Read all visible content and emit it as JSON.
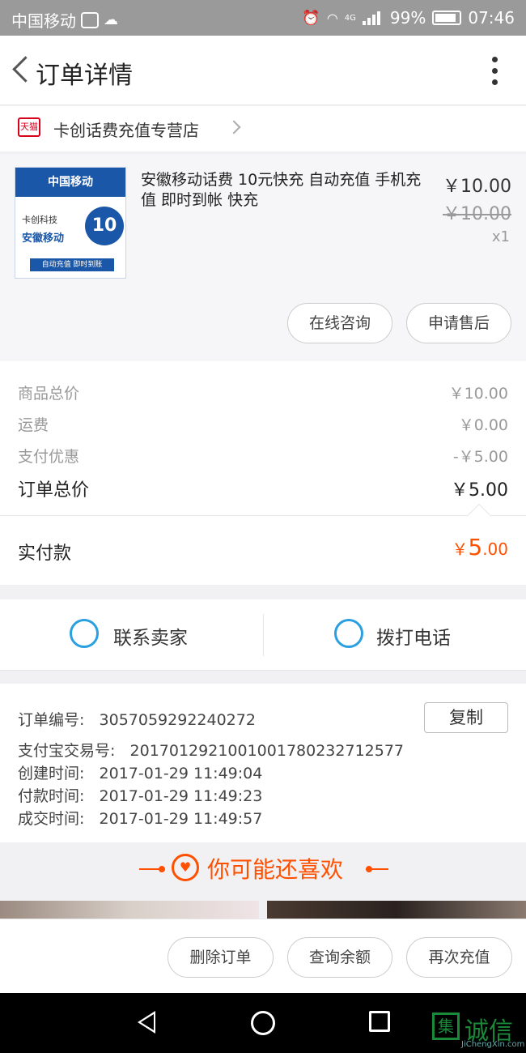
{
  "status_bar": {
    "carrier": "中国移动",
    "network": "4G",
    "battery": "99%",
    "time": "07:46"
  },
  "header": {
    "title": "订单详情"
  },
  "shop": {
    "badge": "天猫",
    "name": "卡创话费充值专营店"
  },
  "product": {
    "thumb_brand": "中国移动",
    "thumb_line1": "卡创科技",
    "thumb_line2": "安徽移动",
    "thumb_badge": "10",
    "thumb_foot": "自动充值 即时到账",
    "name": "安徽移动话费 10元快充 自动充值 手机充值 即时到帐 快充",
    "price": "￥10.00",
    "original_price": "￥10.00",
    "quantity": "x1",
    "btn_consult": "在线咨询",
    "btn_aftersale": "申请售后"
  },
  "summary": {
    "rows": [
      {
        "label": "商品总价",
        "value": "￥10.00"
      },
      {
        "label": "运费",
        "value": "￥0.00"
      },
      {
        "label": "支付优惠",
        "value": "-￥5.00"
      }
    ],
    "total_label": "订单总价",
    "total_value": "￥5.00",
    "paid_label": "实付款",
    "paid_currency": "￥",
    "paid_int": "5",
    "paid_dec": ".00"
  },
  "contact": {
    "seller": "联系卖家",
    "phone": "拨打电话"
  },
  "order_info": {
    "rows": [
      {
        "label": "订单编号:",
        "value": "3057059292240272"
      },
      {
        "label": "支付宝交易号:",
        "value": "2017012921001001780232712577"
      },
      {
        "label": "创建时间:",
        "value": "2017-01-29 11:49:04"
      },
      {
        "label": "付款时间:",
        "value": "2017-01-29 11:49:23"
      },
      {
        "label": "成交时间:",
        "value": "2017-01-29 11:49:57"
      }
    ],
    "copy_label": "复制"
  },
  "recommend": {
    "title": "你可能还喜欢"
  },
  "actions": {
    "delete": "删除订单",
    "balance": "查询余额",
    "recharge": "再次充值"
  },
  "watermark": {
    "glyph": "集",
    "title": "诚信",
    "site": "JiChengXin.com"
  },
  "colors": {
    "accent": "#ff5000",
    "tmall_red": "#d9001b",
    "contact_blue": "#2aa0e0"
  }
}
